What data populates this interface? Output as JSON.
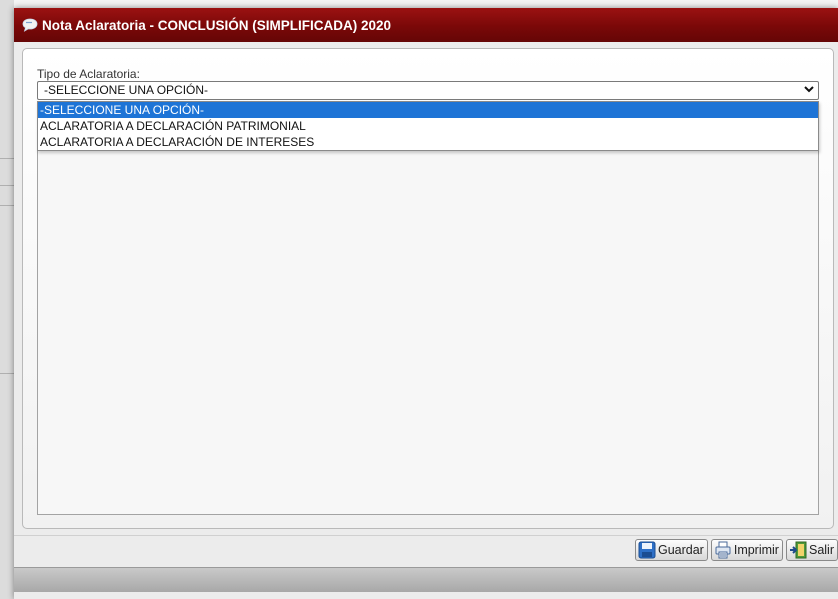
{
  "dialog": {
    "title": "Nota Aclaratoria - CONCLUSIÓN (SIMPLIFICADA) 2020"
  },
  "form": {
    "field_label": "Tipo de Aclaratoria:",
    "selected_value": "-SELECCIONE UNA OPCIÓN-",
    "options": [
      "-SELECCIONE UNA OPCIÓN-",
      "ACLARATORIA A DECLARACIÓN PATRIMONIAL",
      "ACLARATORIA A DECLARACIÓN DE INTERESES"
    ],
    "highlighted_option_index": 0
  },
  "buttons": {
    "save_label": "Guardar",
    "print_label": "Imprimir",
    "exit_label": "Salir"
  },
  "icons": {
    "title": "speech-bubble-icon",
    "save": "floppy-disk-icon",
    "print": "printer-icon",
    "exit": "exit-door-icon"
  },
  "colors": {
    "titlebar": "#7a0808",
    "selected_option": "#1e74d6"
  }
}
